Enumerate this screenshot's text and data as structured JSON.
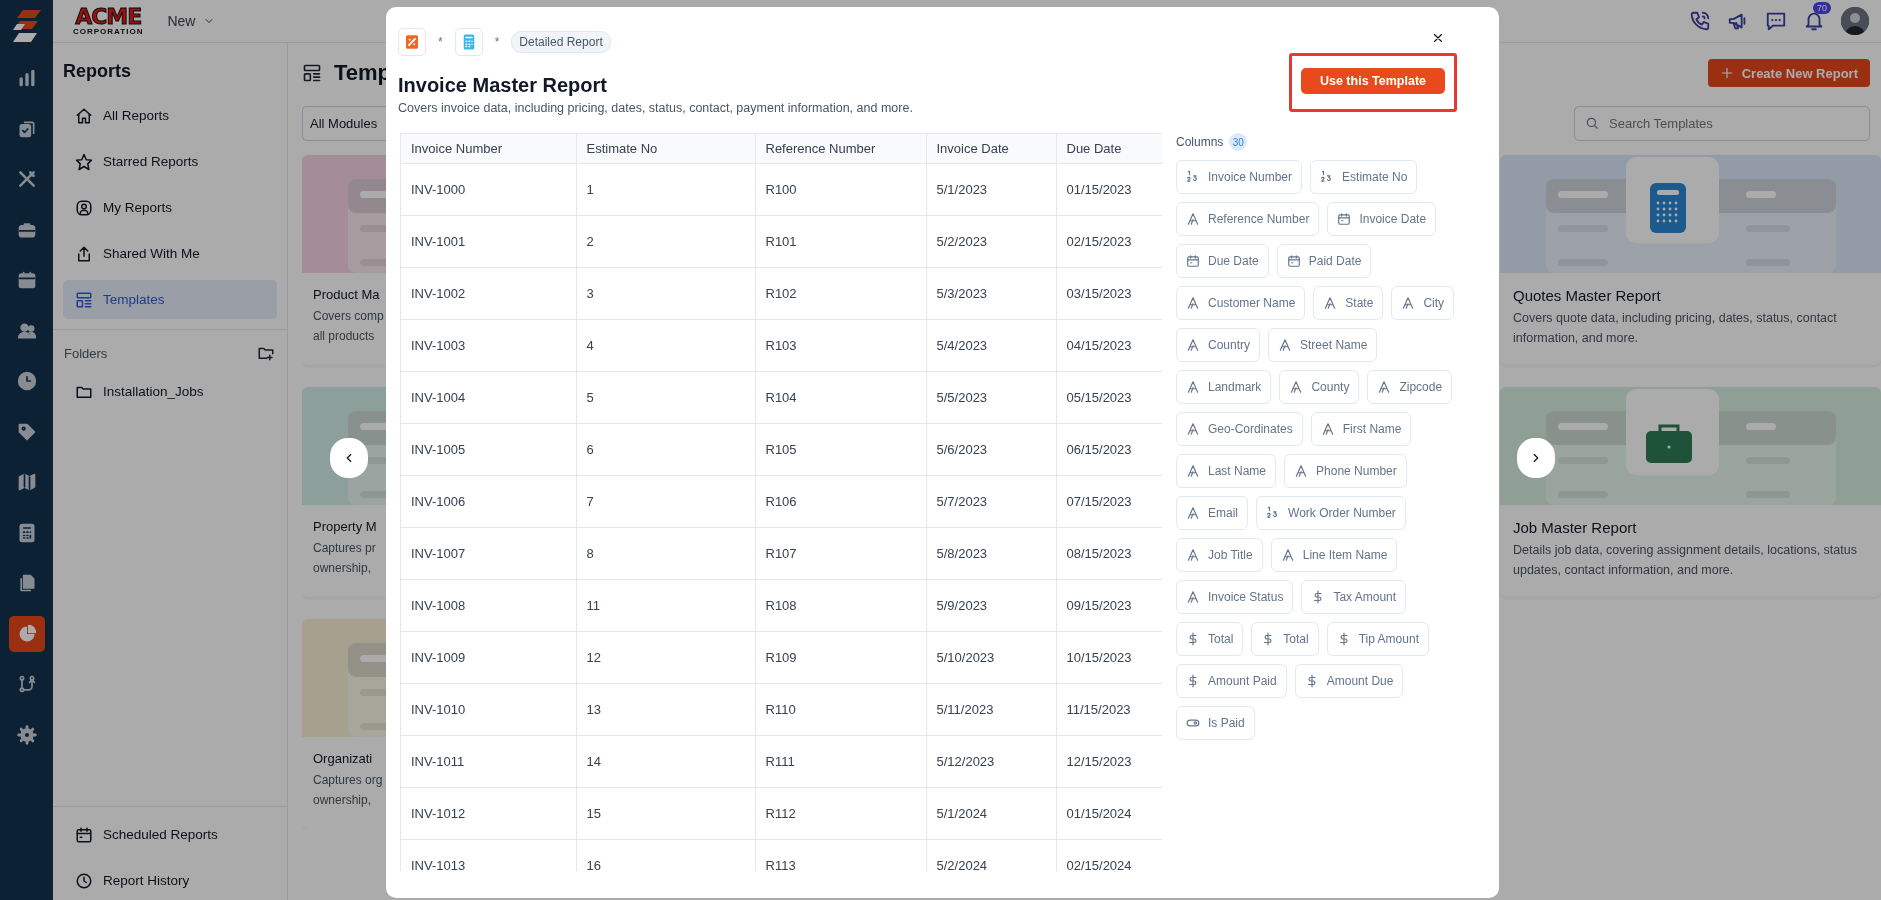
{
  "rail": {
    "items": [
      {
        "selected": false
      },
      {
        "selected": false
      },
      {
        "selected": false
      },
      {
        "selected": false
      },
      {
        "selected": false
      },
      {
        "selected": false
      },
      {
        "selected": false
      },
      {
        "selected": false
      },
      {
        "selected": false
      },
      {
        "selected": false
      },
      {
        "selected": false
      },
      {
        "selected": true
      },
      {
        "selected": false
      },
      {
        "selected": false
      }
    ]
  },
  "header": {
    "logo": "ACME",
    "logo_tagline": "CORPORATION",
    "menu": "New",
    "notifications": "70"
  },
  "sidebar": {
    "title": "Reports",
    "items": [
      {
        "label": "All Reports",
        "selected": false
      },
      {
        "label": "Starred Reports",
        "selected": false
      },
      {
        "label": "My Reports",
        "selected": false
      },
      {
        "label": "Shared With Me",
        "selected": false
      },
      {
        "label": "Templates",
        "selected": true
      }
    ],
    "folders_label": "Folders",
    "folders": [
      {
        "label": "Installation_Jobs"
      }
    ],
    "footer_items": [
      {
        "label": "Scheduled Reports"
      },
      {
        "label": "Report History"
      }
    ]
  },
  "main": {
    "title": "Temp",
    "filter": "All Modules",
    "create_button": "Create New Report",
    "search": {
      "placeholder": "Search Templates"
    },
    "cards_left": [
      {
        "title": "Product Ma",
        "lines": [
          "Covers comp",
          "all products"
        ]
      },
      {
        "title": "Property M",
        "lines": [
          "Captures pr",
          "ownership,"
        ]
      },
      {
        "title": "Organizati",
        "lines": [
          "Captures org",
          "ownership,"
        ]
      }
    ],
    "cards_right": [
      {
        "title": "Quotes Master Report",
        "description": "Covers quote data, including pricing, dates, status, contact information, and more."
      },
      {
        "title": "Job Master Report",
        "description": "Details job data, covering assignment details, locations, status updates, contact information, and more."
      }
    ]
  },
  "modal": {
    "separators": [
      "*",
      "*"
    ],
    "tag": "Detailed Report",
    "title": "Invoice Master Report",
    "description": "Covers invoice data, including pricing, dates, status, contact, payment information, and more.",
    "primary_button": "Use this Template",
    "table": {
      "columns": [
        "Invoice Number",
        "Estimate No",
        "Reference Number",
        "Invoice Date",
        "Due Date"
      ],
      "rows": [
        [
          "INV-1000",
          "1",
          "R100",
          "5/1/2023",
          "01/15/2023"
        ],
        [
          "INV-1001",
          "2",
          "R101",
          "5/2/2023",
          "02/15/2023"
        ],
        [
          "INV-1002",
          "3",
          "R102",
          "5/3/2023",
          "03/15/2023"
        ],
        [
          "INV-1003",
          "4",
          "R103",
          "5/4/2023",
          "04/15/2023"
        ],
        [
          "INV-1004",
          "5",
          "R104",
          "5/5/2023",
          "05/15/2023"
        ],
        [
          "INV-1005",
          "6",
          "R105",
          "5/6/2023",
          "06/15/2023"
        ],
        [
          "INV-1006",
          "7",
          "R106",
          "5/7/2023",
          "07/15/2023"
        ],
        [
          "INV-1007",
          "8",
          "R107",
          "5/8/2023",
          "08/15/2023"
        ],
        [
          "INV-1008",
          "11",
          "R108",
          "5/9/2023",
          "09/15/2023"
        ],
        [
          "INV-1009",
          "12",
          "R109",
          "5/10/2023",
          "10/15/2023"
        ],
        [
          "INV-1010",
          "13",
          "R110",
          "5/11/2023",
          "11/15/2023"
        ],
        [
          "INV-1011",
          "14",
          "R111",
          "5/12/2023",
          "12/15/2023"
        ],
        [
          "INV-1012",
          "15",
          "R112",
          "5/1/2024",
          "01/15/2024"
        ],
        [
          "INV-1013",
          "16",
          "R113",
          "5/2/2024",
          "02/15/2024"
        ]
      ]
    },
    "columns_label": "Columns",
    "columns_count": "30",
    "column_chips": [
      {
        "label": "Invoice Number",
        "kind": "number"
      },
      {
        "label": "Estimate No",
        "kind": "number"
      },
      {
        "label": "Reference Number",
        "kind": "text"
      },
      {
        "label": "Invoice Date",
        "kind": "date"
      },
      {
        "label": "Due Date",
        "kind": "date"
      },
      {
        "label": "Paid Date",
        "kind": "date"
      },
      {
        "label": "Customer Name",
        "kind": "text"
      },
      {
        "label": "State",
        "kind": "text"
      },
      {
        "label": "City",
        "kind": "text"
      },
      {
        "label": "Country",
        "kind": "text"
      },
      {
        "label": "Street Name",
        "kind": "text"
      },
      {
        "label": "Landmark",
        "kind": "text"
      },
      {
        "label": "County",
        "kind": "text"
      },
      {
        "label": "Zipcode",
        "kind": "text"
      },
      {
        "label": "Geo-Cordinates",
        "kind": "text"
      },
      {
        "label": "First Name",
        "kind": "text"
      },
      {
        "label": "Last Name",
        "kind": "text"
      },
      {
        "label": "Phone Number",
        "kind": "text"
      },
      {
        "label": "Email",
        "kind": "text"
      },
      {
        "label": "Work Order Number",
        "kind": "number"
      },
      {
        "label": "Job Title",
        "kind": "text"
      },
      {
        "label": "Line Item Name",
        "kind": "text"
      },
      {
        "label": "Invoice Status",
        "kind": "text"
      },
      {
        "label": "Tax Amount",
        "kind": "currency"
      },
      {
        "label": "Total",
        "kind": "currency"
      },
      {
        "label": "Total",
        "kind": "currency"
      },
      {
        "label": "Tip Amount",
        "kind": "currency"
      },
      {
        "label": "Amount Paid",
        "kind": "currency"
      },
      {
        "label": "Amount Due",
        "kind": "currency"
      },
      {
        "label": "Is Paid",
        "kind": "boolean"
      }
    ]
  }
}
